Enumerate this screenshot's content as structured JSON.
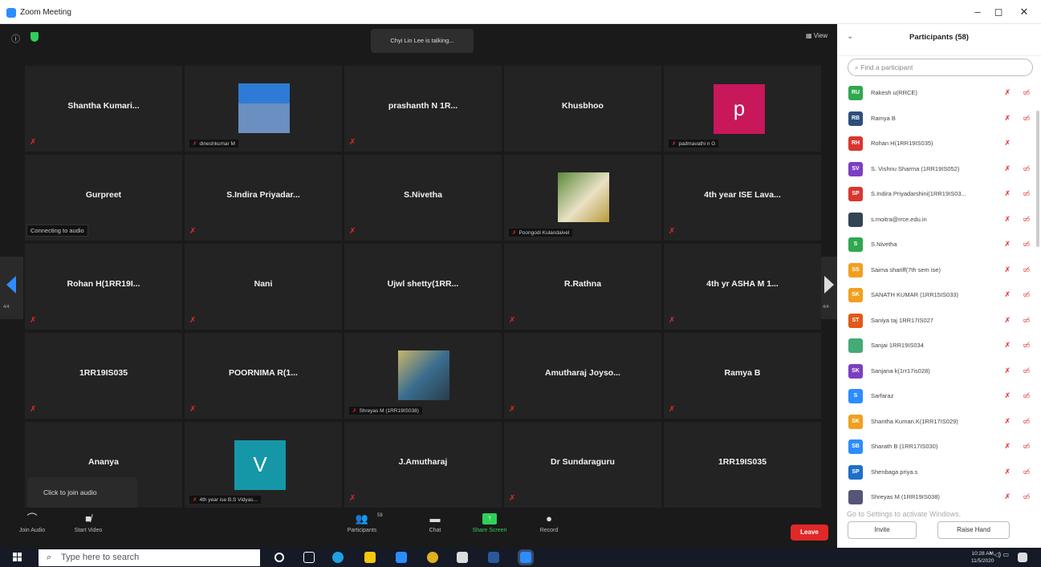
{
  "window": {
    "title": "Zoom Meeting",
    "controls": [
      "–",
      "◻",
      "✕"
    ]
  },
  "meeting": {
    "talking": "Chyi Lin Lee is talking...",
    "view_label": "View",
    "tiles": [
      {
        "name": "Shantha Kumari...",
        "sub": "",
        "kind": "name"
      },
      {
        "name": "",
        "sub": "dineshkumar M",
        "kind": "photo",
        "photo": "man-portrait"
      },
      {
        "name": "prashanth N 1R...",
        "sub": "",
        "kind": "name"
      },
      {
        "name": "Khusbhoo",
        "sub": "",
        "kind": "name",
        "nomic": true
      },
      {
        "name": "",
        "sub": "padmavathi n G",
        "kind": "letter",
        "letter": "p",
        "color": "#c8175a"
      },
      {
        "name": "Gurpreet",
        "sub": "",
        "kind": "name",
        "conn": "Connecting to audio"
      },
      {
        "name": "S.Indira Priyadar...",
        "sub": "",
        "kind": "name"
      },
      {
        "name": "S.Nivetha",
        "sub": "",
        "kind": "name"
      },
      {
        "name": "",
        "sub": "Poongodi Kulandaivel",
        "kind": "photo",
        "photo": "woman-portrait"
      },
      {
        "name": "4th year ISE Lava...",
        "sub": "",
        "kind": "name"
      },
      {
        "name": "Rohan H(1RR19I...",
        "sub": "",
        "kind": "name"
      },
      {
        "name": "Nani",
        "sub": "",
        "kind": "name"
      },
      {
        "name": "Ujwl shetty(1RR...",
        "sub": "",
        "kind": "name",
        "nomic": true
      },
      {
        "name": "R.Rathna",
        "sub": "",
        "kind": "name"
      },
      {
        "name": "4th yr ASHA M 1...",
        "sub": "",
        "kind": "name"
      },
      {
        "name": "1RR19IS035",
        "sub": "",
        "kind": "name"
      },
      {
        "name": "POORNIMA R(1...",
        "sub": "",
        "kind": "name"
      },
      {
        "name": "",
        "sub": "Shreyas M (1RR19IS038)",
        "kind": "photo",
        "photo": "boy-portrait"
      },
      {
        "name": "Amutharaj Joyso...",
        "sub": "",
        "kind": "name"
      },
      {
        "name": "Ramya B",
        "sub": "",
        "kind": "name"
      },
      {
        "name": "Ananya",
        "sub": "",
        "kind": "name",
        "nomic": true
      },
      {
        "name": "",
        "sub": "4th year ise B.S Vidyas...",
        "kind": "letter",
        "letter": "V",
        "color": "#1597a8"
      },
      {
        "name": "J.Amutharaj",
        "sub": "",
        "kind": "name"
      },
      {
        "name": "Dr Sundaraguru",
        "sub": "",
        "kind": "name"
      },
      {
        "name": "1RR19IS035",
        "sub": "",
        "kind": "name",
        "nomic": true
      }
    ],
    "page_left": "4/4",
    "page_right": "4/4",
    "join_audio_tip": "Click to join audio",
    "controls": {
      "join_audio": "Join Audio",
      "start_video": "Start Video",
      "participants": "Participants",
      "participants_count": "58",
      "chat": "Chat",
      "share_screen": "Share Screen",
      "record": "Record",
      "leave": "Leave"
    }
  },
  "participants_panel": {
    "title": "Participants (58)",
    "search_placeholder": "Find a participant",
    "rows": [
      {
        "initials": "RU",
        "color": "#2fa84f",
        "name": "Rakesh u(RRCE)"
      },
      {
        "initials": "RB",
        "color": "#2d4f7c",
        "name": "Ramya B"
      },
      {
        "initials": "RH",
        "color": "#d9362f",
        "name": "Rohan H(1RR19IS035)"
      },
      {
        "initials": "SV",
        "color": "#7b3fc2",
        "name": "S. Vishnu Sharma (1RR19IS052)"
      },
      {
        "initials": "SP",
        "color": "#d9362f",
        "name": "S.Indira Priyadarshini(1RR19IS03..."
      },
      {
        "initials": "",
        "color": "#345",
        "name": "s.moitra@rrce.edu.in",
        "photo": true
      },
      {
        "initials": "S",
        "color": "#2fa84f",
        "name": "S.Nivetha"
      },
      {
        "initials": "SS",
        "color": "#f0a020",
        "name": "Saima shariff(7th sem ise)"
      },
      {
        "initials": "SK",
        "color": "#f0a020",
        "name": "SANATH KUMAR (1RR15IS033)"
      },
      {
        "initials": "ST",
        "color": "#e05a1a",
        "name": "Saniya taj 1RR17IS027"
      },
      {
        "initials": "",
        "color": "#4a7",
        "name": "Sanjai 1RR19IS034",
        "photo": true
      },
      {
        "initials": "SK",
        "color": "#7b3fc2",
        "name": "Sanjana k(1rr17is028)"
      },
      {
        "initials": "S",
        "color": "#2d8cff",
        "name": "Sarfaraz"
      },
      {
        "initials": "SK",
        "color": "#f0a020",
        "name": "Shantha Kumari.K(1RR17IS029)"
      },
      {
        "initials": "SB",
        "color": "#2d8cff",
        "name": "Sharath B (1RR17IS030)"
      },
      {
        "initials": "SP",
        "color": "#1e6fc9",
        "name": "Shenbaga priya.s"
      },
      {
        "initials": "",
        "color": "#557",
        "name": "Shreyas M (1RR19IS038)",
        "photo": true
      }
    ],
    "activate_text": "Go to Settings to activate Windows.",
    "invite_label": "Invite",
    "raise_hand_label": "Raise Hand"
  },
  "taskbar": {
    "search_placeholder": "Type here to search",
    "time": "10:28 AM",
    "date": "11/5/2020"
  }
}
